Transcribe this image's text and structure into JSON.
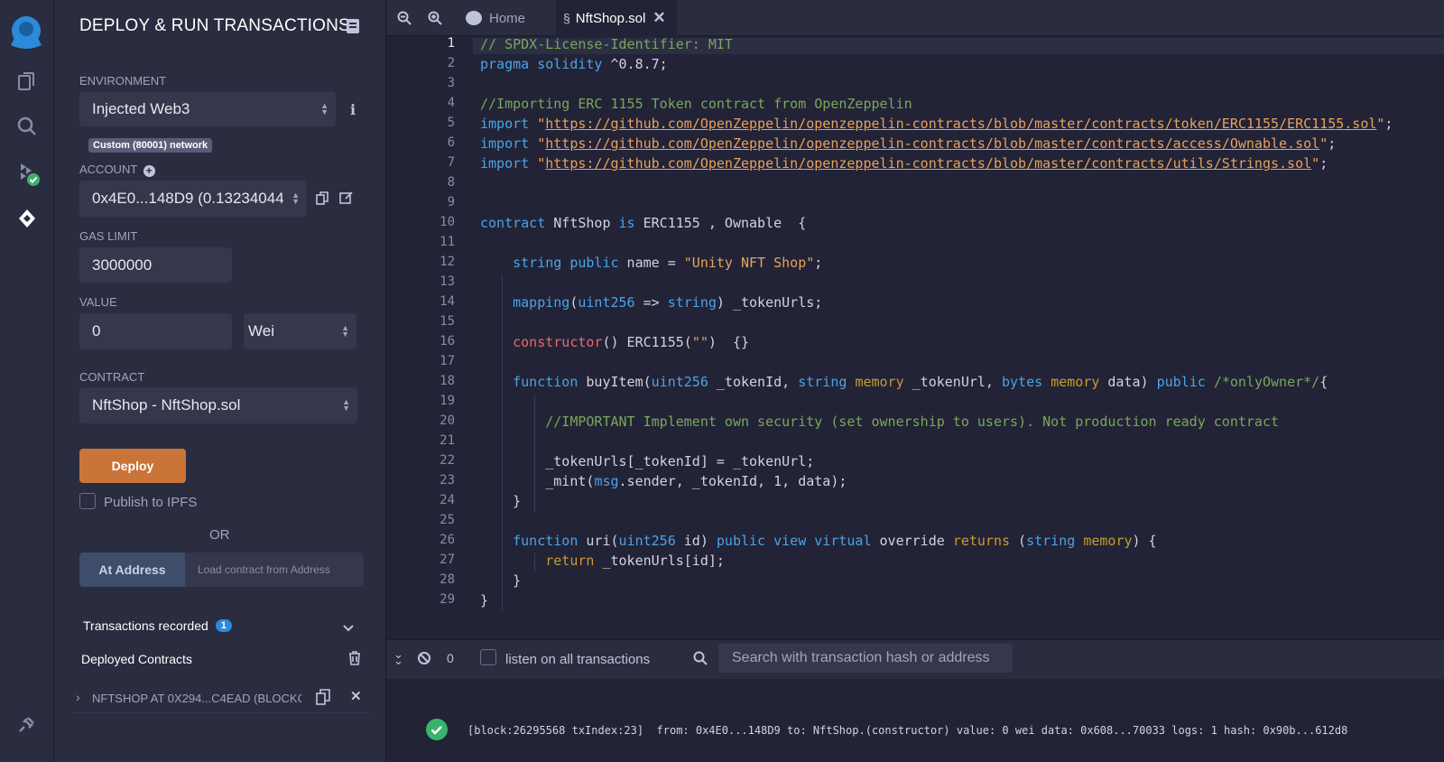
{
  "sidebar": {
    "icons": [
      "remix-logo-icon",
      "file-explorer-icon",
      "search-icon",
      "solidity-compiler-icon",
      "deploy-run-icon",
      "plugin-manager-icon"
    ]
  },
  "panel": {
    "title": "DEPLOY & RUN TRANSACTIONS",
    "environment_label": "ENVIRONMENT",
    "environment_value": "Injected Web3",
    "network_badge": "Custom (80001) network",
    "account_label": "ACCOUNT",
    "account_value": "0x4E0...148D9 (0.13234044",
    "gas_limit_label": "GAS LIMIT",
    "gas_limit_value": "3000000",
    "value_label": "VALUE",
    "value_value": "0",
    "value_unit": "Wei",
    "contract_label": "CONTRACT",
    "contract_value": "NftShop - NftShop.sol",
    "deploy_label": "Deploy",
    "publish_label": "Publish to IPFS",
    "or_label": "OR",
    "at_address_label": "At Address",
    "load_address_placeholder": "Load contract from Address",
    "transactions_recorded_label": "Transactions recorded",
    "transactions_recorded_count": "1",
    "deployed_contracts_label": "Deployed Contracts",
    "deployed_instance": "NFTSHOP AT 0X294...C4EAD (BLOCKCH"
  },
  "tabs": [
    {
      "label": "Home"
    },
    {
      "label": "NftShop.sol"
    }
  ],
  "code": {
    "line_numbers": [
      "1",
      "2",
      "3",
      "4",
      "5",
      "6",
      "7",
      "8",
      "9",
      "10",
      "11",
      "12",
      "13",
      "14",
      "15",
      "16",
      "17",
      "18",
      "19",
      "20",
      "21",
      "22",
      "23",
      "24",
      "25",
      "26",
      "27",
      "28",
      "29"
    ]
  },
  "terminal": {
    "pending_count": "0",
    "listen_label": "listen on all transactions",
    "search_placeholder": "Search with transaction hash or address",
    "log_line": "[block:26295568 txIndex:23]  from: 0x4E0...148D9 to: NftShop.(constructor) value: 0 wei data: 0x608...70033 logs: 1 hash: 0x90b...612d8"
  },
  "colors": {
    "accent": "#c97539",
    "background": "#222336",
    "panel": "#2a2c3f",
    "success": "#3bb26b"
  }
}
